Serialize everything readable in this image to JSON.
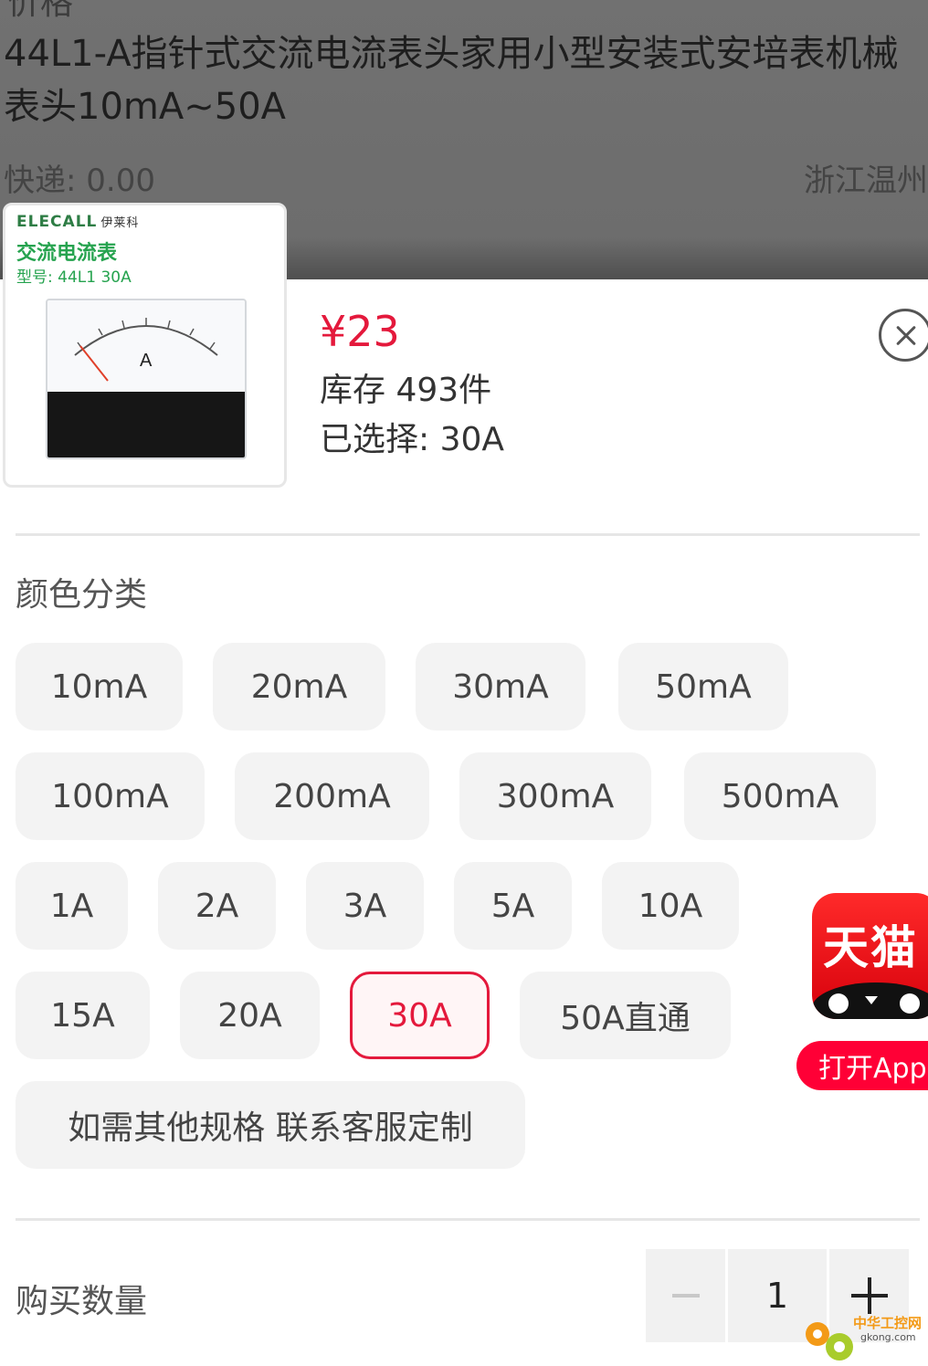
{
  "background_page": {
    "top_fragment": "价格",
    "product_title": "44L1-A指针式交流电流表头家用小型安装式安培表机械表头10mA~50A",
    "shipping": "快递: 0.00",
    "location": "浙江温州"
  },
  "sku_panel": {
    "thumbnail": {
      "brand": "ELECALL",
      "brand_cn": "伊莱科",
      "product_name": "交流电流表",
      "model": "型号: 44L1  30A"
    },
    "price": "¥23",
    "stock": "库存 493件",
    "selected": "已选择: 30A",
    "close_icon": "close-icon",
    "group_title": "颜色分类",
    "options": [
      {
        "label": "10mA",
        "selected": false
      },
      {
        "label": "20mA",
        "selected": false
      },
      {
        "label": "30mA",
        "selected": false
      },
      {
        "label": "50mA",
        "selected": false
      },
      {
        "label": "100mA",
        "selected": false
      },
      {
        "label": "200mA",
        "selected": false
      },
      {
        "label": "300mA",
        "selected": false
      },
      {
        "label": "500mA",
        "selected": false
      },
      {
        "label": "1A",
        "selected": false
      },
      {
        "label": "2A",
        "selected": false
      },
      {
        "label": "3A",
        "selected": false
      },
      {
        "label": "5A",
        "selected": false
      },
      {
        "label": "10A",
        "selected": false
      },
      {
        "label": "15A",
        "selected": false
      },
      {
        "label": "20A",
        "selected": false
      },
      {
        "label": "30A",
        "selected": true
      },
      {
        "label": "50A直通",
        "selected": false
      },
      {
        "label": "如需其他规格 联系客服定制",
        "selected": false
      }
    ],
    "quantity": {
      "label": "购买数量",
      "value": "1",
      "minus_icon": "minus-icon",
      "plus_icon": "plus-icon"
    }
  },
  "tmall_badge": {
    "logo_text": "天猫",
    "open_app_label": "打开App"
  },
  "watermark": {
    "text_cn": "中华工控网",
    "text_en": "gkong.com"
  },
  "colors": {
    "accent": "#e4193c",
    "tmall_red": "#ff0036",
    "option_bg": "#f3f3f3"
  }
}
